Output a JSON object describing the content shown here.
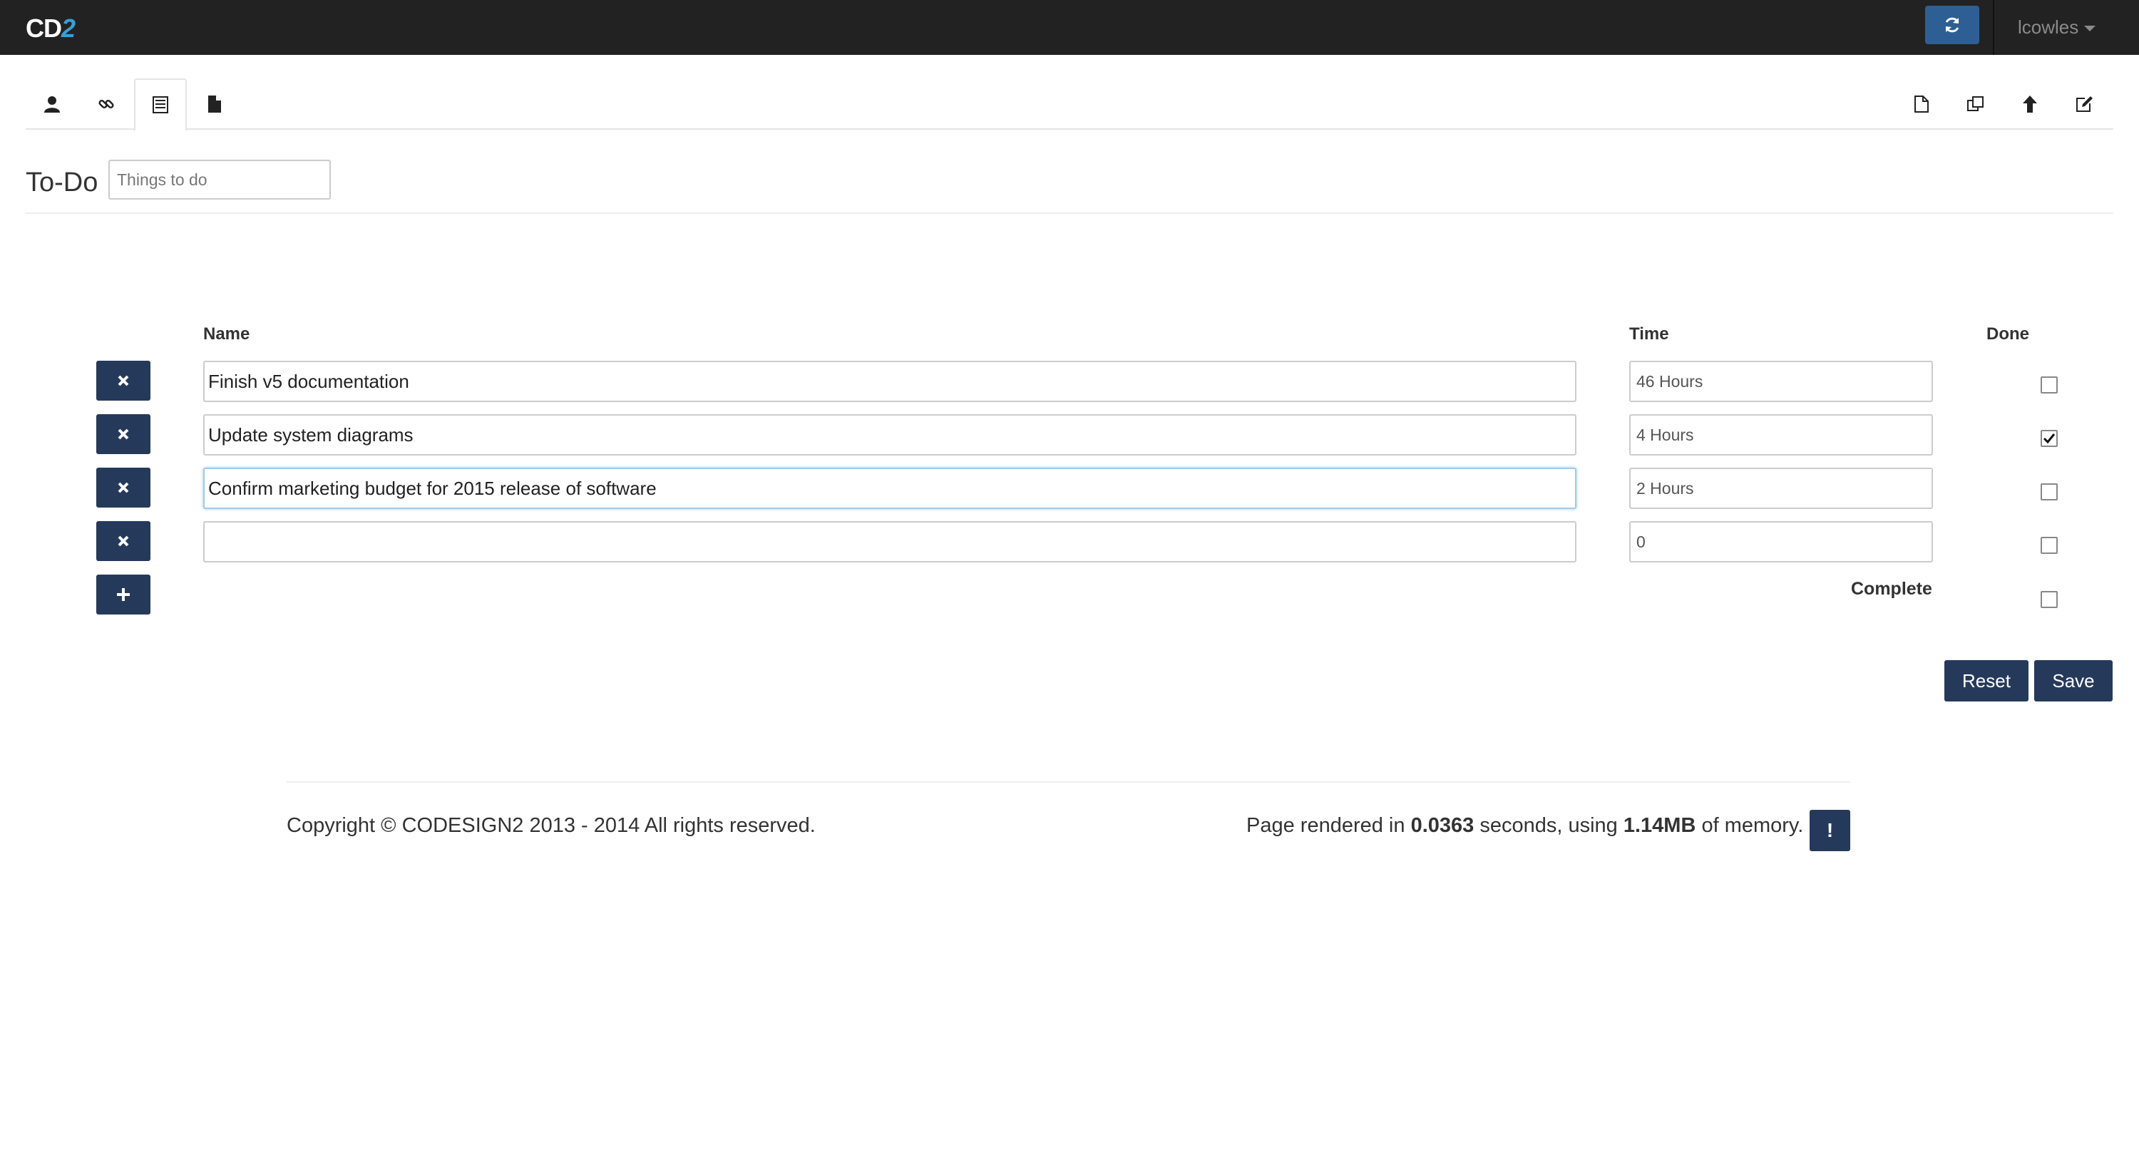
{
  "app": {
    "brand_prefix": "CD",
    "brand_suffix": "2",
    "user": "lcowles"
  },
  "tabs": [
    {
      "icon": "user-icon"
    },
    {
      "icon": "link-icon"
    },
    {
      "icon": "list-icon",
      "active": true
    },
    {
      "icon": "file-icon"
    }
  ],
  "toolbar": [
    {
      "icon": "new-document-icon"
    },
    {
      "icon": "copy-icon"
    },
    {
      "icon": "arrow-up-icon"
    },
    {
      "icon": "edit-icon"
    }
  ],
  "header": {
    "title": "To-Do",
    "name_placeholder": "Things to do"
  },
  "table": {
    "columns": {
      "name": "Name",
      "time": "Time",
      "done": "Done"
    },
    "rows": [
      {
        "name": "Finish v5 documentation",
        "time": "46 Hours",
        "done": false
      },
      {
        "name": "Update system diagrams",
        "time": "4 Hours",
        "done": true
      },
      {
        "name": "Confirm marketing budget for 2015 release of software",
        "time": "2 Hours",
        "done": false
      },
      {
        "name": "",
        "time": "0",
        "done": false
      }
    ],
    "complete_label": "Complete",
    "complete_checked": false
  },
  "actions": {
    "reset_label": "Reset",
    "save_label": "Save"
  },
  "footer": {
    "copyright": "Copyright © CODESIGN2 2013 - 2014 All rights reserved.",
    "render_prefix": "Page rendered in ",
    "render_time": "0.0363",
    "render_mid": " seconds, using ",
    "render_memory": "1.14MB",
    "render_suffix": " of memory.",
    "debug_label": "!"
  },
  "colors": {
    "navbar": "#222222",
    "brand_accent": "#3a9fd6",
    "button": "#253a5b",
    "refresh_button": "#2e5f94"
  }
}
